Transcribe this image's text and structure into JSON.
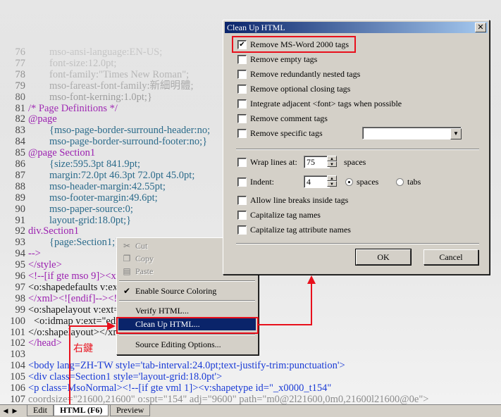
{
  "editor": {
    "lines": [
      {
        "n": "76",
        "text": "mso-ansi-language:EN-US;"
      },
      {
        "n": "77",
        "text": "font-size:12.0pt;"
      },
      {
        "n": "78",
        "text": "font-family:\"Times New Roman\";"
      },
      {
        "n": "79",
        "text": "mso-fareast-font-family:新細明體;"
      },
      {
        "n": "80",
        "text": "mso-font-kerning:1.0pt;}"
      },
      {
        "n": "81",
        "text": "/* Page Definitions */"
      },
      {
        "n": "82",
        "text": "@page"
      },
      {
        "n": "83",
        "text": "{mso-page-border-surround-header:no;"
      },
      {
        "n": "84",
        "text": "mso-page-border-surround-footer:no;}"
      },
      {
        "n": "85",
        "text": "@page Section1"
      },
      {
        "n": "86",
        "text": "{size:595.3pt 841.9pt;"
      },
      {
        "n": "87",
        "text": "margin:72.0pt 46.3pt 72.0pt 45.0pt;"
      },
      {
        "n": "88",
        "text": "mso-header-margin:42.55pt;"
      },
      {
        "n": "89",
        "text": "mso-footer-margin:49.6pt;"
      },
      {
        "n": "90",
        "text": "mso-paper-source:0;"
      },
      {
        "n": "91",
        "text": "layout-grid:18.0pt;}"
      },
      {
        "n": "92",
        "text": "div.Section1"
      },
      {
        "n": "93",
        "text": "{page:Section1;}"
      },
      {
        "n": "94",
        "text": "-->"
      },
      {
        "n": "95",
        "text": "</style>"
      },
      {
        "n": "96",
        "text": "<!--[if gte mso 9]><xml>"
      },
      {
        "n": "97",
        "text": "<o:shapedefaults v:ext=\"edit\" spidmax=\"1027\"/>"
      },
      {
        "n": "98",
        "text": "</xml><![endif]--><!--[if gte mso 9]><xml>"
      },
      {
        "n": "99",
        "text": "<o:shapelayout v:ext=\"edit\">"
      },
      {
        "n": "100",
        "text": "<o:idmap v:ext=\"edit\" data=\"1\"/>"
      },
      {
        "n": "101",
        "text": "</o:shapelayout></xml><![endif]-->"
      },
      {
        "n": "102",
        "text": "</head>"
      },
      {
        "n": "103",
        "text": ""
      },
      {
        "n": "104",
        "text": "<body lang=ZH-TW style='tab-interval:24.0pt;text-justify-trim:punctuation'>"
      },
      {
        "n": "105",
        "text": "<div class=Section1 style='layout-grid:18.0pt'>"
      },
      {
        "n": "106",
        "text": "<p class=MsoNormal><!--[if gte vml 1]><v:shapetype id=\"_x0000_t154\""
      },
      {
        "n": "107",
        "text": "coordsize=\"21600,21600\" o:spt=\"154\" adj=\"9600\" path=\"m0@2l21600,0m0,21600l21600@0e\">"
      }
    ],
    "annotation_label": "右鍵"
  },
  "tabbar": {
    "tabs": [
      {
        "label": "Edit",
        "active": false
      },
      {
        "label": "HTML (F6)",
        "active": true
      },
      {
        "label": "Preview",
        "active": false
      }
    ]
  },
  "context_menu": {
    "items": [
      {
        "label": "Cut",
        "icon": "cut-icon",
        "enabled": false
      },
      {
        "label": "Copy",
        "icon": "copy-icon",
        "enabled": false
      },
      {
        "label": "Paste",
        "icon": "paste-icon",
        "enabled": false
      },
      {
        "label": "Enable Source Coloring",
        "icon": "check-icon",
        "enabled": true,
        "checked": true
      },
      {
        "label": "Verify HTML...",
        "enabled": true
      },
      {
        "label": "Clean Up HTML...",
        "enabled": true,
        "selected": true
      },
      {
        "label": "Source Editing Options...",
        "enabled": true
      }
    ]
  },
  "dialog": {
    "title": "Clean Up HTML",
    "checkboxes": [
      {
        "label": "Remove MS-Word 2000 tags",
        "checked": true
      },
      {
        "label": "Remove empty tags",
        "checked": false
      },
      {
        "label": "Remove redundantly nested tags",
        "checked": false
      },
      {
        "label": "Remove optional closing tags",
        "checked": false
      },
      {
        "label": "Integrate adjacent <font> tags when possible",
        "checked": false
      },
      {
        "label": "Remove comment tags",
        "checked": false
      },
      {
        "label": "Remove specific tags",
        "checked": false
      }
    ],
    "specific_tags_value": "",
    "wrap": {
      "label": "Wrap lines at:",
      "value": "75",
      "unit": "spaces",
      "checked": false
    },
    "indent": {
      "label": "Indent:",
      "value": "4",
      "option_spaces": "spaces",
      "option_tabs": "tabs",
      "selected": "spaces",
      "checked": false
    },
    "other_checkboxes": [
      {
        "label": "Allow line breaks inside tags",
        "checked": false
      },
      {
        "label": "Capitalize tag names",
        "checked": false
      },
      {
        "label": "Capitalize tag attribute names",
        "checked": false
      }
    ],
    "ok_label": "OK",
    "cancel_label": "Cancel"
  }
}
